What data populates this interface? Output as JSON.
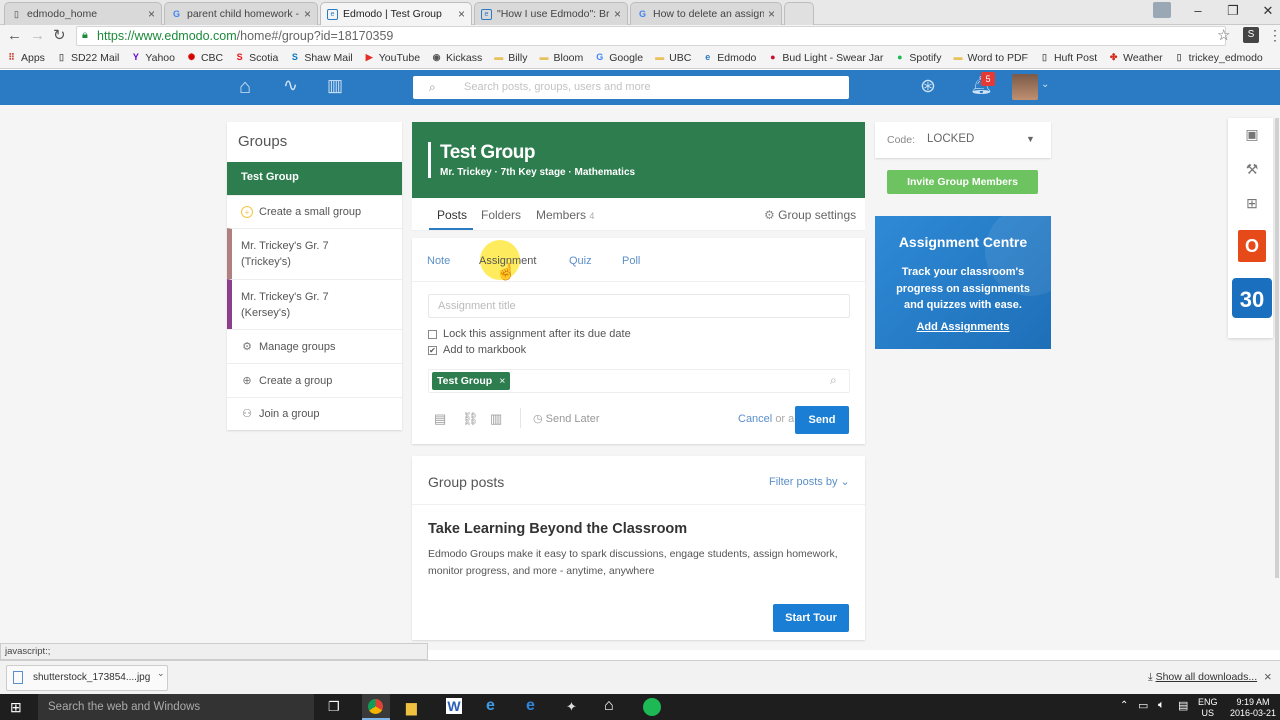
{
  "browser": {
    "tabs": [
      {
        "title": "edmodo_home",
        "icon": "doc-icon"
      },
      {
        "title": "parent child homework -",
        "icon": "google-icon"
      },
      {
        "title": "Edmodo | Test Group",
        "icon": "edmodo-icon"
      },
      {
        "title": "\"How I use Edmodo\": Brill",
        "icon": "edmodo-icon"
      },
      {
        "title": "How to delete an assignm",
        "icon": "google-icon"
      }
    ],
    "url_domain": "https://www.edmodo.com",
    "url_path": "/home#/group?id=18170359",
    "bookmarks": [
      {
        "label": "Apps",
        "icon": "apps-grid-icon",
        "color": "#d04a3b"
      },
      {
        "label": "SD22 Mail",
        "icon": "doc-icon",
        "color": "#666666"
      },
      {
        "label": "Yahoo",
        "icon": "yahoo-icon",
        "color": "#5f01d1"
      },
      {
        "label": "CBC",
        "icon": "cbc-icon",
        "color": "#d40000"
      },
      {
        "label": "Scotia",
        "icon": "scotia-icon",
        "color": "#ec111a"
      },
      {
        "label": "Shaw Mail",
        "icon": "shaw-icon",
        "color": "#0a77bd"
      },
      {
        "label": "YouTube",
        "icon": "youtube-icon",
        "color": "#e52d27"
      },
      {
        "label": "Kickass",
        "icon": "kickass-icon",
        "color": "#555555"
      },
      {
        "label": "Billy",
        "icon": "folder-icon",
        "color": "#e8c15a"
      },
      {
        "label": "Bloom",
        "icon": "folder-icon",
        "color": "#e8c15a"
      },
      {
        "label": "Google",
        "icon": "google-icon",
        "color": "#4285f4"
      },
      {
        "label": "UBC",
        "icon": "folder-icon",
        "color": "#e8c15a"
      },
      {
        "label": "Edmodo",
        "icon": "edmodo-icon",
        "color": "#2b7bc4"
      },
      {
        "label": "Bud Light - Swear Jar",
        "icon": "budlight-icon",
        "color": "#c8102e"
      },
      {
        "label": "Spotify",
        "icon": "spotify-icon",
        "color": "#1db954"
      },
      {
        "label": "Word to PDF",
        "icon": "folder-icon",
        "color": "#e8c15a"
      },
      {
        "label": "Huft Post",
        "icon": "doc-icon",
        "color": "#666666"
      },
      {
        "label": "Weather",
        "icon": "maple-leaf-icon",
        "color": "#d52b1e"
      },
      {
        "label": "trickey_edmodo",
        "icon": "doc-icon",
        "color": "#666666"
      }
    ]
  },
  "edmodo": {
    "search_placeholder": "Search posts, groups, users and more",
    "notification_count": "5",
    "sidebar": {
      "title": "Groups",
      "active_group": "Test Group",
      "create_small": "Create a small group",
      "groups": [
        {
          "line1": "Mr. Trickey's Gr. 7",
          "line2": "(Trickey's)",
          "color": "#b08080"
        },
        {
          "line1": "Mr. Trickey's Gr. 7",
          "line2": "(Kersey's)",
          "color": "#8b3f8b"
        }
      ],
      "manage": "Manage groups",
      "create": "Create a group",
      "join": "Join a group"
    },
    "group": {
      "name": "Test Group",
      "subtitle": "Mr. Trickey · 7th Key stage · Mathematics",
      "tabs": [
        "Posts",
        "Folders",
        "Members"
      ],
      "members_count": "4",
      "settings": "Group settings"
    },
    "composer": {
      "types": [
        "Note",
        "Assignment",
        "Quiz",
        "Poll"
      ],
      "title_placeholder": "Assignment title",
      "lock_label": "Lock this assignment after its due date",
      "markbook_label": "Add to markbook",
      "recipient": "Test Group",
      "send_later": "Send Later",
      "cancel": "Cancel",
      "or_a": "or a",
      "send": "Send"
    },
    "posts": {
      "header": "Group posts",
      "filter": "Filter posts by",
      "promo_title": "Take Learning Beyond the Classroom",
      "promo_text": "Edmodo Groups make it easy to spark discussions, engage students, assign homework, monitor progress, and more - anytime, anywhere",
      "tour_button": "Start Tour"
    },
    "right": {
      "code_label": "Code:",
      "code_value": "LOCKED",
      "invite": "Invite Group Members",
      "centre_title": "Assignment Centre",
      "centre_text": "Track your classroom's progress on assignments and quizzes with ease.",
      "centre_link": "Add Assignments",
      "calendar_day": "30"
    },
    "colors": {
      "brand_blue": "#2b7bc4",
      "group_green": "#2e7d4f",
      "send_blue": "#1a7fd4"
    }
  },
  "status": {
    "link": "javascript:;"
  },
  "downloads": {
    "file": "shutterstock_173854....jpg",
    "show_all": "Show all downloads..."
  },
  "taskbar": {
    "search": "Search the web and Windows",
    "lang1": "ENG",
    "lang2": "US",
    "time": "9:19 AM",
    "date": "2016-03-21"
  }
}
